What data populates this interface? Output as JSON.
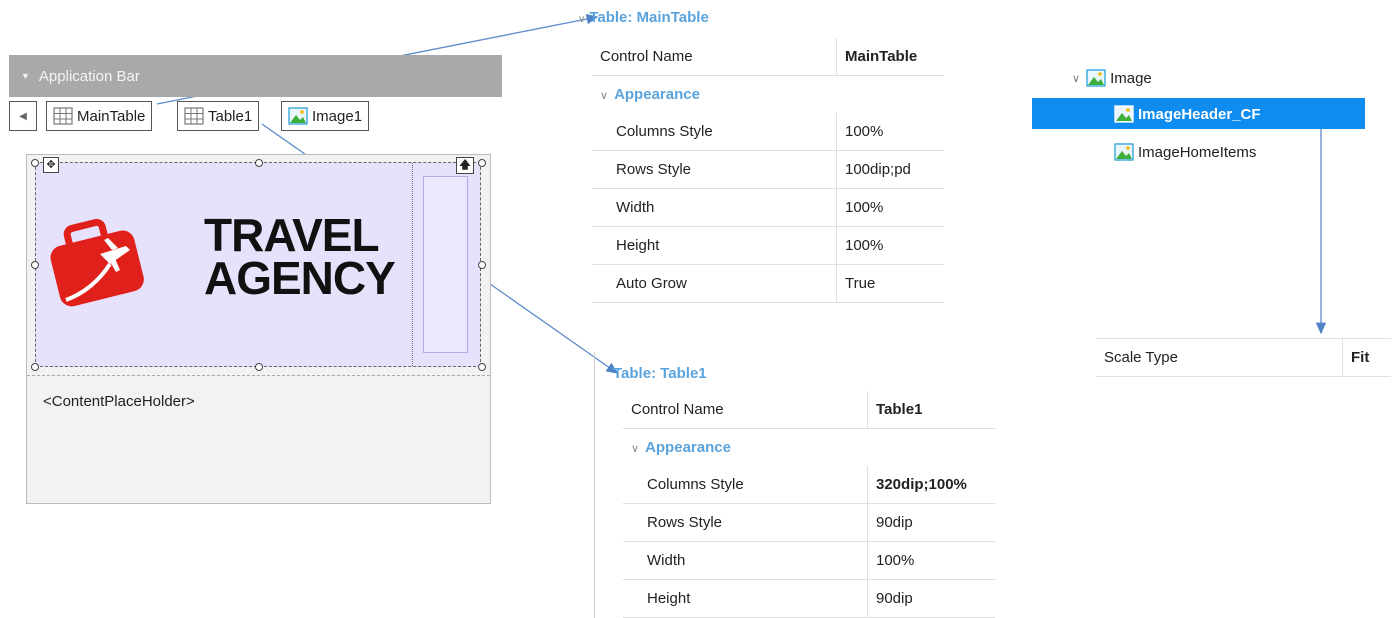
{
  "designer": {
    "app_bar_label": "Application Bar",
    "controls": [
      {
        "label": "MainTable"
      },
      {
        "label": "Table1"
      },
      {
        "label": "Image1"
      }
    ],
    "logo_text_line1": "TRAVEL",
    "logo_text_line2": "AGENCY",
    "content_placeholder": "<ContentPlaceHolder>"
  },
  "main_table_props": {
    "title": "Table: MainTable",
    "control_name_label": "Control Name",
    "control_name_value": "MainTable",
    "section": "Appearance",
    "rows": [
      {
        "key": "Columns Style",
        "value": "100%"
      },
      {
        "key": "Rows Style",
        "value": "100dip;pd"
      },
      {
        "key": "Width",
        "value": "100%"
      },
      {
        "key": "Height",
        "value": "100%"
      },
      {
        "key": "Auto Grow",
        "value": "True"
      }
    ]
  },
  "table1_props": {
    "title": "Table: Table1",
    "control_name_label": "Control Name",
    "control_name_value": "Table1",
    "section": "Appearance",
    "rows": [
      {
        "key": "Columns Style",
        "value": "320dip;100%"
      },
      {
        "key": "Rows Style",
        "value": "90dip"
      },
      {
        "key": "Width",
        "value": "100%"
      },
      {
        "key": "Height",
        "value": "90dip"
      }
    ]
  },
  "image_tree": {
    "root": "Image",
    "items": [
      "ImageHeader_CF",
      "ImageHomeItems"
    ],
    "selected_index": 0
  },
  "image_props": {
    "key": "Scale Type",
    "value": "Fit"
  },
  "colors": {
    "accent": "#5aa3dc",
    "selection": "#0f8cf0",
    "canvas_fill": "#e6e2fb",
    "logo_red": "#e0201b",
    "app_bar": "#a9a9a9"
  }
}
